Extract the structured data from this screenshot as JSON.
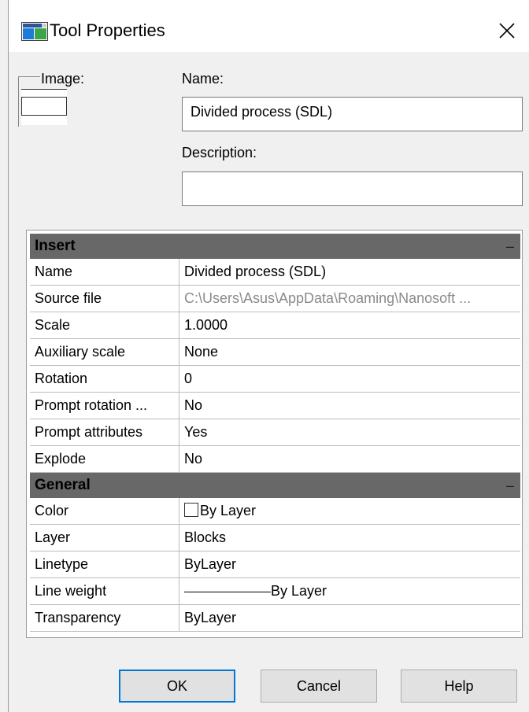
{
  "window": {
    "title": "Tool Properties"
  },
  "image_section": {
    "label": "Image:"
  },
  "name_field": {
    "label": "Name:",
    "value": "Divided process (SDL)"
  },
  "description_field": {
    "label": "Description:",
    "value": ""
  },
  "properties": {
    "insert": {
      "header": "Insert",
      "collapse_symbol": "–",
      "rows": [
        {
          "key": "Name",
          "value": "Divided process (SDL)"
        },
        {
          "key": "Source file",
          "value": "C:\\Users\\Asus\\AppData\\Roaming\\Nanosoft ..."
        },
        {
          "key": "Scale",
          "value": "1.0000"
        },
        {
          "key": "Auxiliary scale",
          "value": "None"
        },
        {
          "key": "Rotation",
          "value": "0"
        },
        {
          "key": "Prompt rotation ...",
          "value": "No"
        },
        {
          "key": "Prompt attributes",
          "value": "Yes"
        },
        {
          "key": "Explode",
          "value": "No"
        }
      ]
    },
    "general": {
      "header": "General",
      "collapse_symbol": "–",
      "rows": [
        {
          "key": "Color",
          "value": "By Layer"
        },
        {
          "key": "Layer",
          "value": "Blocks"
        },
        {
          "key": "Linetype",
          "value": "ByLayer"
        },
        {
          "key": "Line weight",
          "value": "By Layer"
        },
        {
          "key": "Transparency",
          "value": "ByLayer"
        }
      ]
    }
  },
  "buttons": {
    "ok": "OK",
    "cancel": "Cancel",
    "help": "Help"
  },
  "colors": {
    "accent": "#0078d7",
    "category_header": "#686868",
    "muted_text": "#8a8a8a"
  }
}
